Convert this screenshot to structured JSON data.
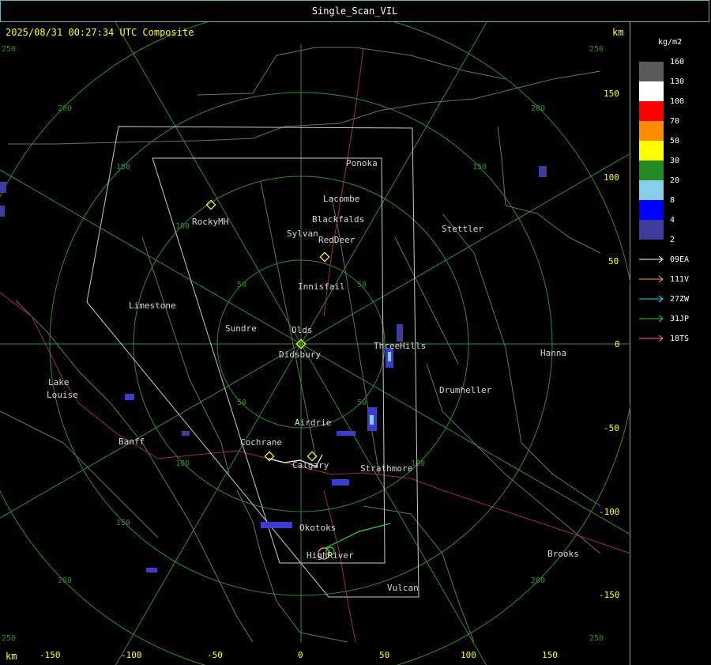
{
  "title": "Single_Scan_VIL",
  "timestamp": "2025/08/31 00:27:34 UTC Composite",
  "km_top": "km",
  "km_bottom": "km",
  "legend": {
    "unit": "kg/m2",
    "levels": [
      {
        "label": "160",
        "color": "#5a5a5a"
      },
      {
        "label": "130",
        "color": "#ffffff"
      },
      {
        "label": "100",
        "color": "#ff0000"
      },
      {
        "label": "70",
        "color": "#ff8c00"
      },
      {
        "label": "50",
        "color": "#ffff00"
      },
      {
        "label": "30",
        "color": "#228b22"
      },
      {
        "label": "20",
        "color": "#87ceeb"
      },
      {
        "label": "8",
        "color": "#0000ff"
      },
      {
        "label": "4",
        "color": "#3c3c9c"
      },
      {
        "label": "2",
        "color": ""
      }
    ],
    "tracks": [
      {
        "label": "09EA",
        "color": "#ffffff"
      },
      {
        "label": "111V",
        "color": "#ffa060"
      },
      {
        "label": "27ZW",
        "color": "#00e5ee"
      },
      {
        "label": "31JP",
        "color": "#32cd32"
      },
      {
        "label": "18TS",
        "color": "#ff60c0"
      }
    ]
  },
  "axes": {
    "x_ticks": [
      "-150",
      "-100",
      "-50",
      "0",
      "50",
      "100",
      "150"
    ],
    "y_ticks": [
      "150",
      "100",
      "50",
      "0",
      "-50",
      "-100",
      "-150"
    ],
    "range_rings": [
      "50",
      "100",
      "150",
      "200",
      "250"
    ]
  },
  "places": [
    "Ponoka",
    "Lacombe",
    "Blackfalds",
    "Sylvan",
    "RedDeer",
    "Stettler",
    "RockyMH",
    "Innisfail",
    "Limestone",
    "Sundre",
    "Olds",
    "Didsbury",
    "ThreeHills",
    "Hanna",
    "Drumheller",
    "Lake",
    "Louise",
    "Airdrie",
    "Banff",
    "Cochrane",
    "Calgary",
    "Strathmore",
    "Okotoks",
    "HighRiver",
    "Brooks",
    "Vulcan"
  ]
}
